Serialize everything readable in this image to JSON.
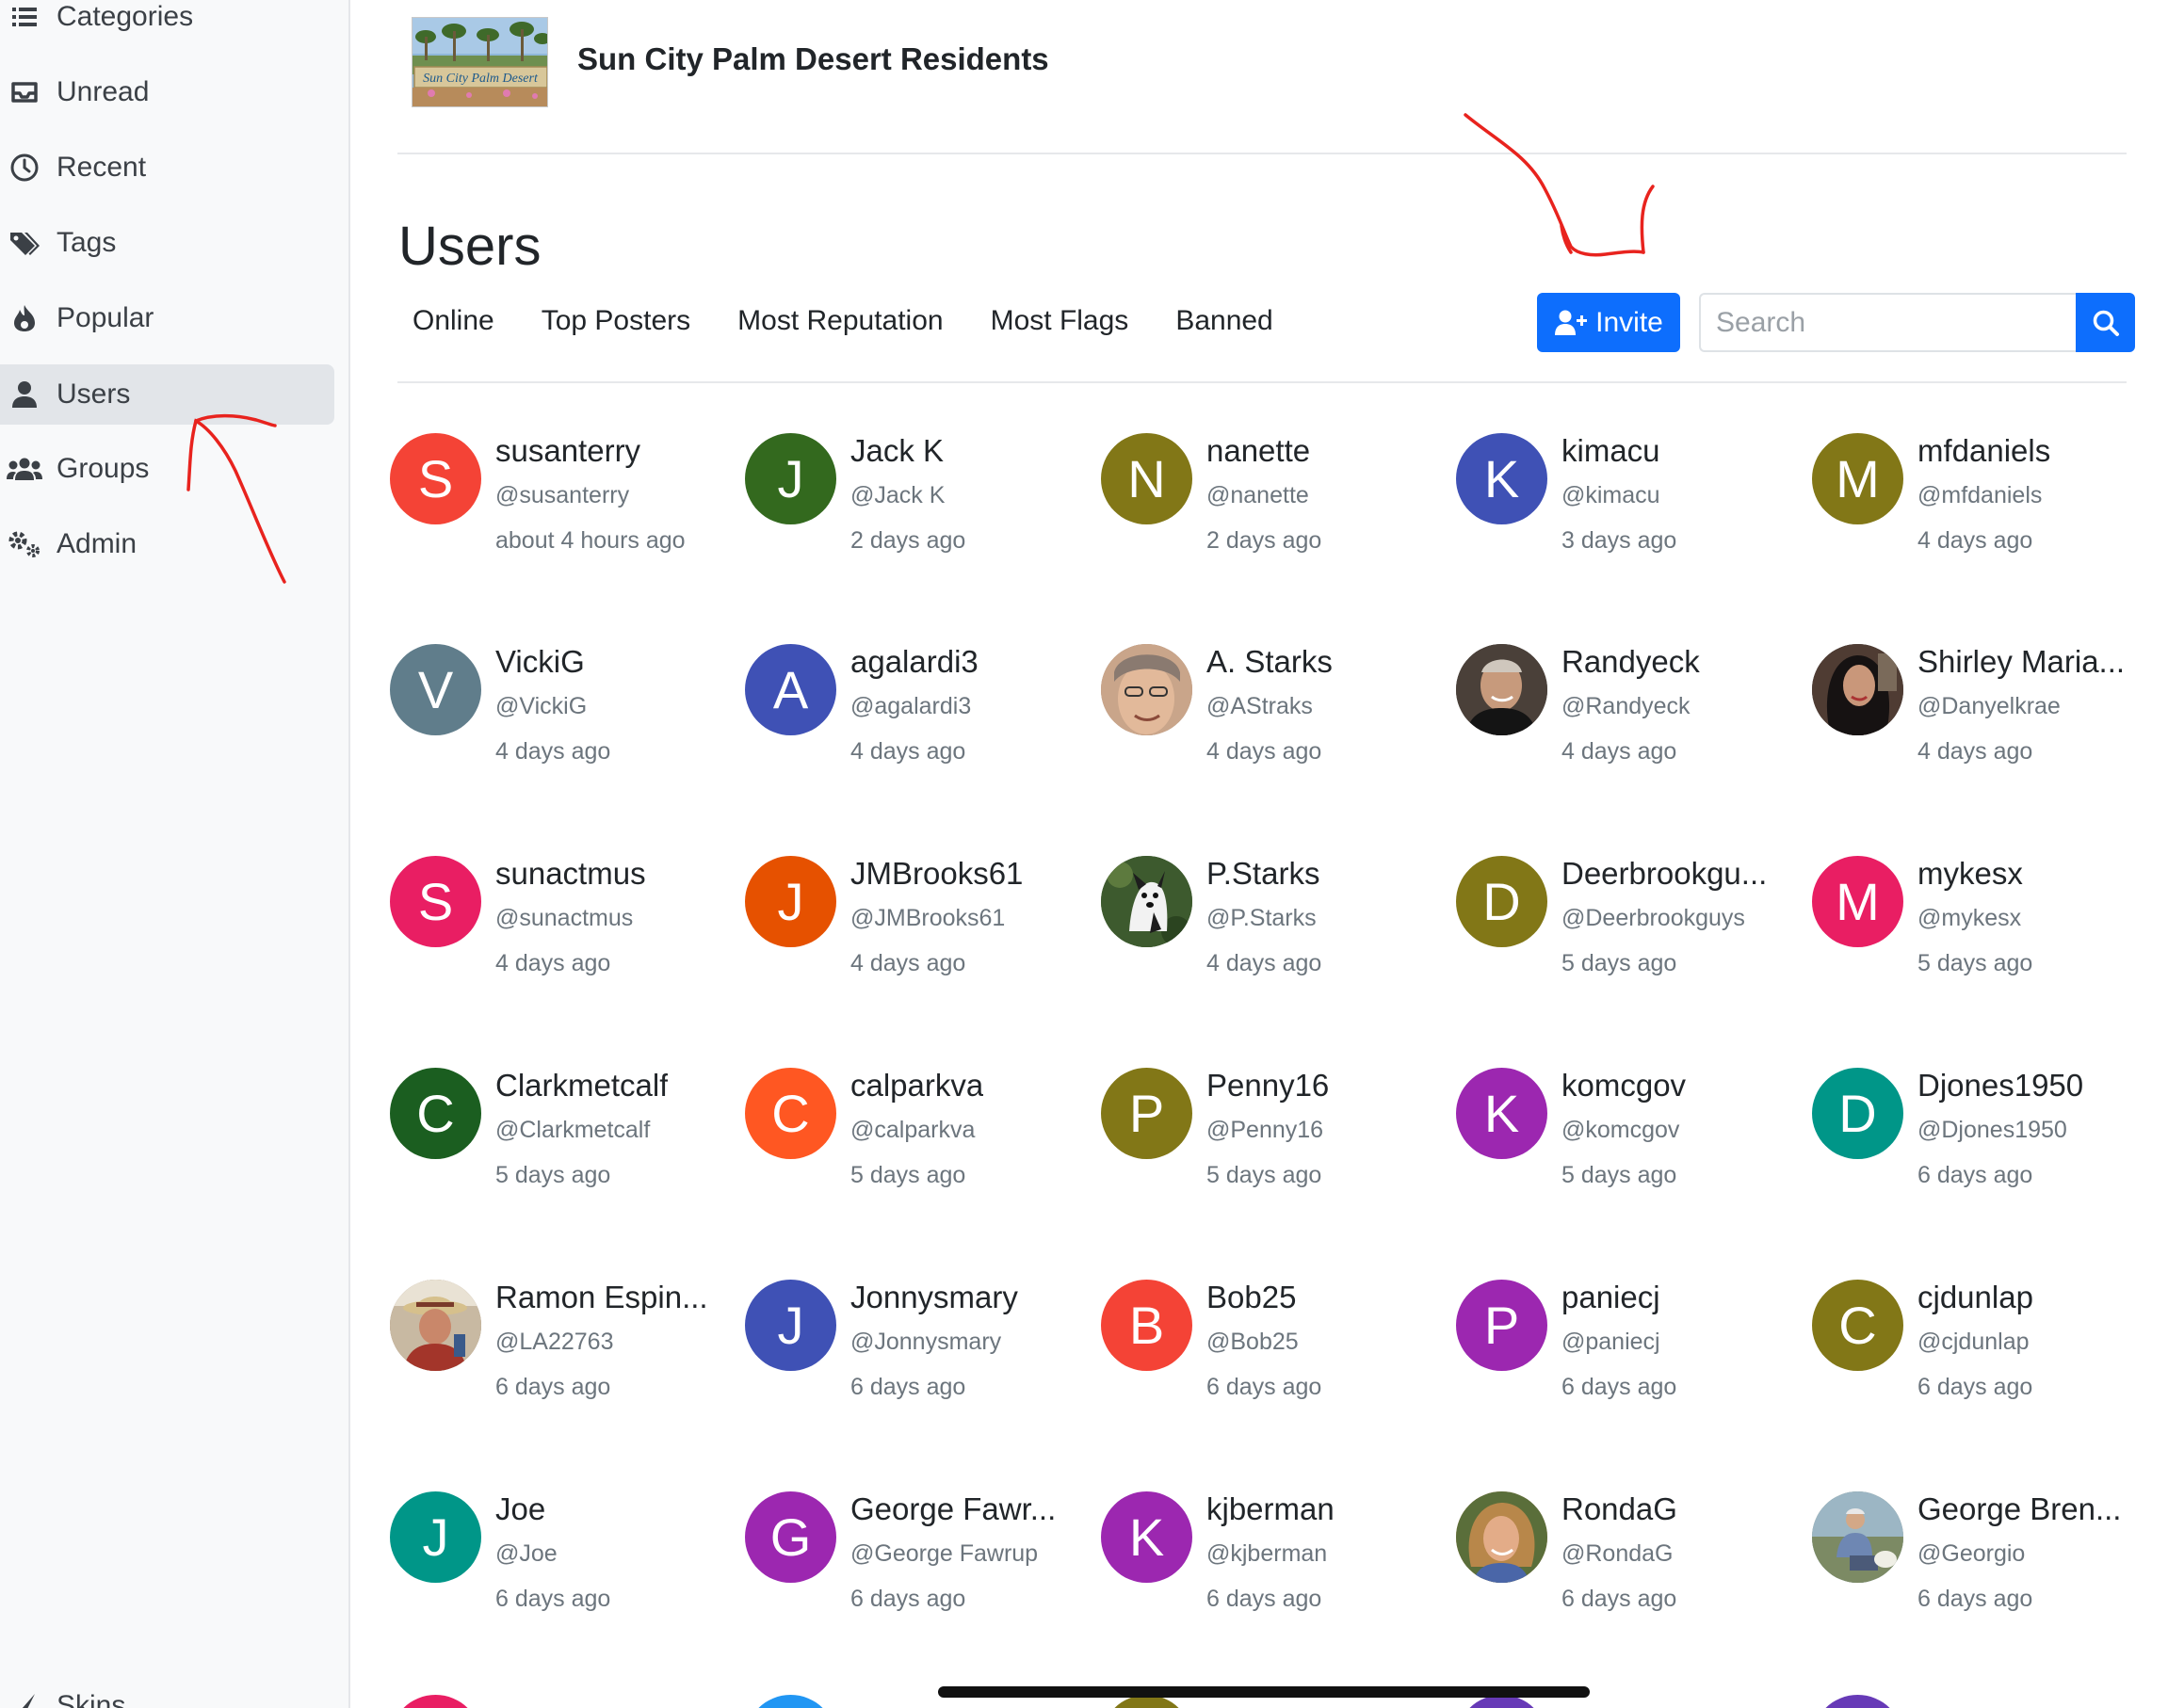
{
  "sidebar": {
    "items": [
      {
        "label": "Categories",
        "icon": "list-icon",
        "active": false
      },
      {
        "label": "Unread",
        "icon": "inbox-icon",
        "active": false
      },
      {
        "label": "Recent",
        "icon": "clock-icon",
        "active": false
      },
      {
        "label": "Tags",
        "icon": "tags-icon",
        "active": false
      },
      {
        "label": "Popular",
        "icon": "fire-icon",
        "active": false
      },
      {
        "label": "Users",
        "icon": "user-icon",
        "active": true
      },
      {
        "label": "Groups",
        "icon": "users-icon",
        "active": false
      },
      {
        "label": "Admin",
        "icon": "gears-icon",
        "active": false
      }
    ],
    "skins_label": "Skins"
  },
  "header": {
    "site_title": "Sun City Palm Desert Residents",
    "logo_text": "Sun City Palm Desert"
  },
  "page": {
    "title": "Users",
    "tabs": [
      "Online",
      "Top Posters",
      "Most Reputation",
      "Most Flags",
      "Banned"
    ],
    "invite_label": "Invite",
    "search_placeholder": "Search"
  },
  "colors": {
    "primary": "#0d6efd",
    "annotation": "#e8231e"
  },
  "users": [
    {
      "name": "susanterry",
      "handle": "@susanterry",
      "seen": "about 4 hours ago",
      "letter": "S",
      "color": "#f44336"
    },
    {
      "name": "Jack K",
      "handle": "@Jack K",
      "seen": "2 days ago",
      "letter": "J",
      "color": "#33691e"
    },
    {
      "name": "nanette",
      "handle": "@nanette",
      "seen": "2 days ago",
      "letter": "N",
      "color": "#827717"
    },
    {
      "name": "kimacu",
      "handle": "@kimacu",
      "seen": "3 days ago",
      "letter": "K",
      "color": "#3f51b5"
    },
    {
      "name": "mfdaniels",
      "handle": "@mfdaniels",
      "seen": "4 days ago",
      "letter": "M",
      "color": "#827717"
    },
    {
      "name": "VickiG",
      "handle": "@VickiG",
      "seen": "4 days ago",
      "letter": "V",
      "color": "#607d8b"
    },
    {
      "name": "agalardi3",
      "handle": "@agalardi3",
      "seen": "4 days ago",
      "letter": "A",
      "color": "#3f51b5"
    },
    {
      "name": "A. Starks",
      "handle": "@AStraks",
      "seen": "4 days ago",
      "letter": "",
      "color": "#a07a5e",
      "photo": "face-light"
    },
    {
      "name": "Randyeck",
      "handle": "@Randyeck",
      "seen": "4 days ago",
      "letter": "",
      "color": "#3a3430",
      "photo": "face-dark"
    },
    {
      "name": "Shirley Maria...",
      "handle": "@Danyelkrae",
      "seen": "4 days ago",
      "letter": "",
      "color": "#2a2424",
      "photo": "face-hair"
    },
    {
      "name": "sunactmus",
      "handle": "@sunactmus",
      "seen": "4 days ago",
      "letter": "S",
      "color": "#e91e63"
    },
    {
      "name": "JMBrooks61",
      "handle": "@JMBrooks61",
      "seen": "4 days ago",
      "letter": "J",
      "color": "#e65100"
    },
    {
      "name": "P.Starks",
      "handle": "@P.Starks",
      "seen": "4 days ago",
      "letter": "",
      "color": "#3d5a2e",
      "photo": "dog"
    },
    {
      "name": "Deerbrookgu...",
      "handle": "@Deerbrookguys",
      "seen": "5 days ago",
      "letter": "D",
      "color": "#827717"
    },
    {
      "name": "mykesx",
      "handle": "@mykesx",
      "seen": "5 days ago",
      "letter": "M",
      "color": "#e91e63"
    },
    {
      "name": "Clarkmetcalf",
      "handle": "@Clarkmetcalf",
      "seen": "5 days ago",
      "letter": "C",
      "color": "#1b5e20"
    },
    {
      "name": "calparkva",
      "handle": "@calparkva",
      "seen": "5 days ago",
      "letter": "C",
      "color": "#ff5722"
    },
    {
      "name": "Penny16",
      "handle": "@Penny16",
      "seen": "5 days ago",
      "letter": "P",
      "color": "#827717"
    },
    {
      "name": "komcgov",
      "handle": "@komcgov",
      "seen": "5 days ago",
      "letter": "K",
      "color": "#9c27b0"
    },
    {
      "name": "Djones1950",
      "handle": "@Djones1950",
      "seen": "6 days ago",
      "letter": "D",
      "color": "#009688"
    },
    {
      "name": "Ramon Espin...",
      "handle": "@LA22763",
      "seen": "6 days ago",
      "letter": "",
      "color": "#8a6a4a",
      "photo": "face-hat"
    },
    {
      "name": "Jonnysmary",
      "handle": "@Jonnysmary",
      "seen": "6 days ago",
      "letter": "J",
      "color": "#3f51b5"
    },
    {
      "name": "Bob25",
      "handle": "@Bob25",
      "seen": "6 days ago",
      "letter": "B",
      "color": "#f44336"
    },
    {
      "name": "paniecj",
      "handle": "@paniecj",
      "seen": "6 days ago",
      "letter": "P",
      "color": "#9c27b0"
    },
    {
      "name": "cjdunlap",
      "handle": "@cjdunlap",
      "seen": "6 days ago",
      "letter": "C",
      "color": "#827717"
    },
    {
      "name": "Joe",
      "handle": "@Joe",
      "seen": "6 days ago",
      "letter": "J",
      "color": "#009688"
    },
    {
      "name": "George Fawr...",
      "handle": "@George Fawrup",
      "seen": "6 days ago",
      "letter": "G",
      "color": "#9c27b0"
    },
    {
      "name": "kjberman",
      "handle": "@kjberman",
      "seen": "6 days ago",
      "letter": "K",
      "color": "#9c27b0"
    },
    {
      "name": "RondaG",
      "handle": "@RondaG",
      "seen": "6 days ago",
      "letter": "",
      "color": "#c98b5a",
      "photo": "face-blonde"
    },
    {
      "name": "George Bren...",
      "handle": "@Georgio",
      "seen": "6 days ago",
      "letter": "",
      "color": "#6d7d6a",
      "photo": "outdoor"
    }
  ],
  "peek_colors": [
    "#e91e63",
    "#2196f3",
    "#827717",
    "#673ab7",
    "#673ab7"
  ]
}
